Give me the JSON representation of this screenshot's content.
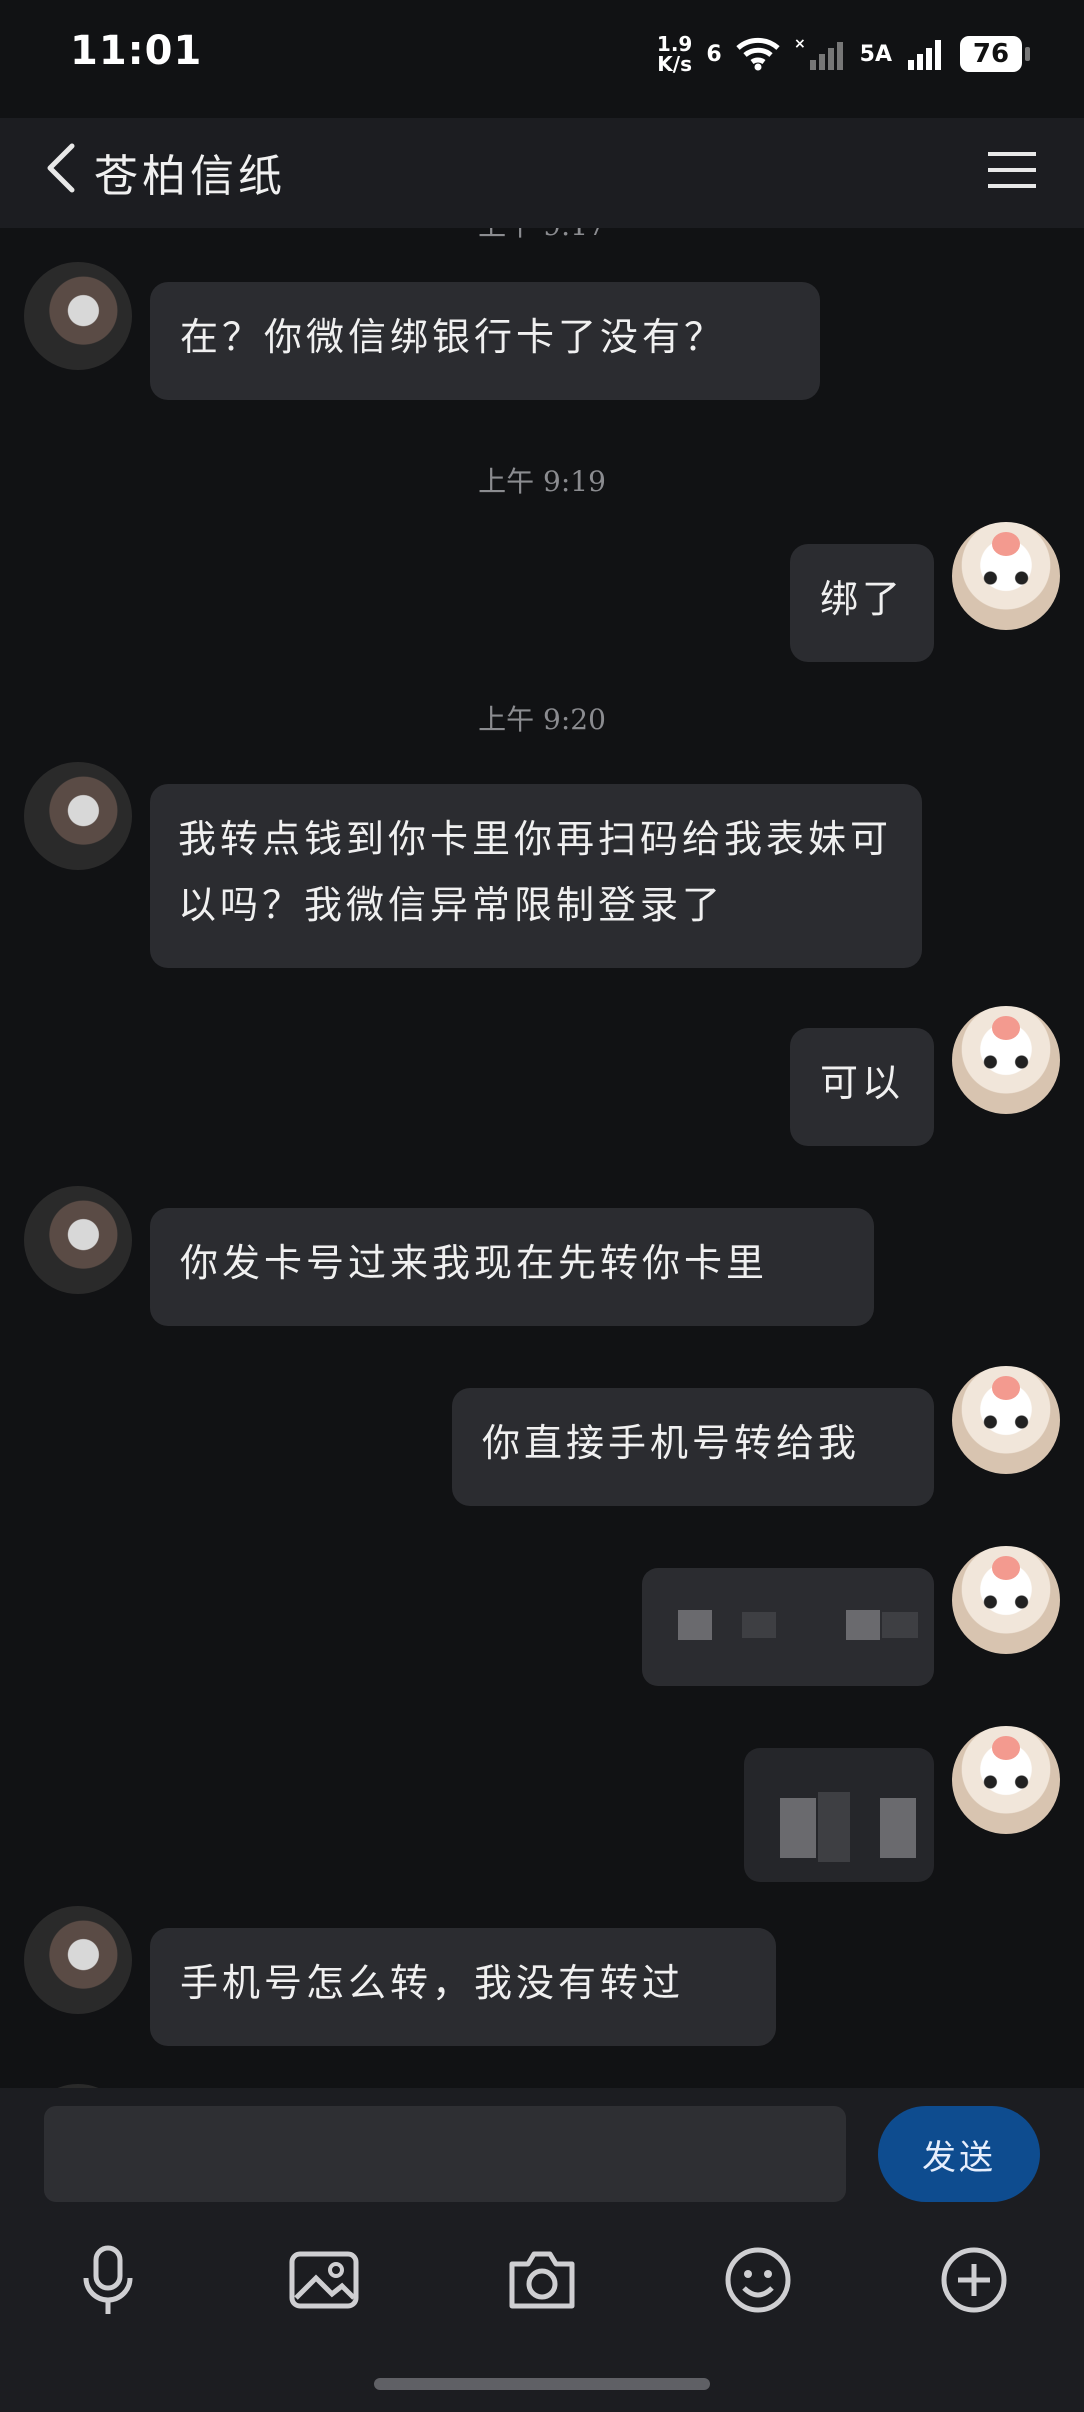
{
  "status": {
    "time": "11:01",
    "net_speed_value": "1.9",
    "net_speed_unit": "K/s",
    "wifi_tag": "6",
    "signal_tag": "5A",
    "battery": "76"
  },
  "header": {
    "title": "苍柏信纸"
  },
  "messages": {
    "m1": "在？你微信绑银行卡了没有？",
    "t1": "上午 9:19",
    "m2": "绑了",
    "t2": "上午 9:20",
    "m3": "我转点钱到你卡里你再扫码给我表妹可以吗？我微信异常限制登录了",
    "m4": "可以",
    "m5": "你发卡号过来我现在先转你卡里",
    "m6": "你直接手机号转给我",
    "m7": "手机号怎么转，我没有转过"
  },
  "composer": {
    "input_value": "",
    "send_label": "发送"
  },
  "toolbar": {
    "icons": [
      "microphone-icon",
      "image-icon",
      "camera-icon",
      "emoji-icon",
      "plus-icon"
    ]
  }
}
